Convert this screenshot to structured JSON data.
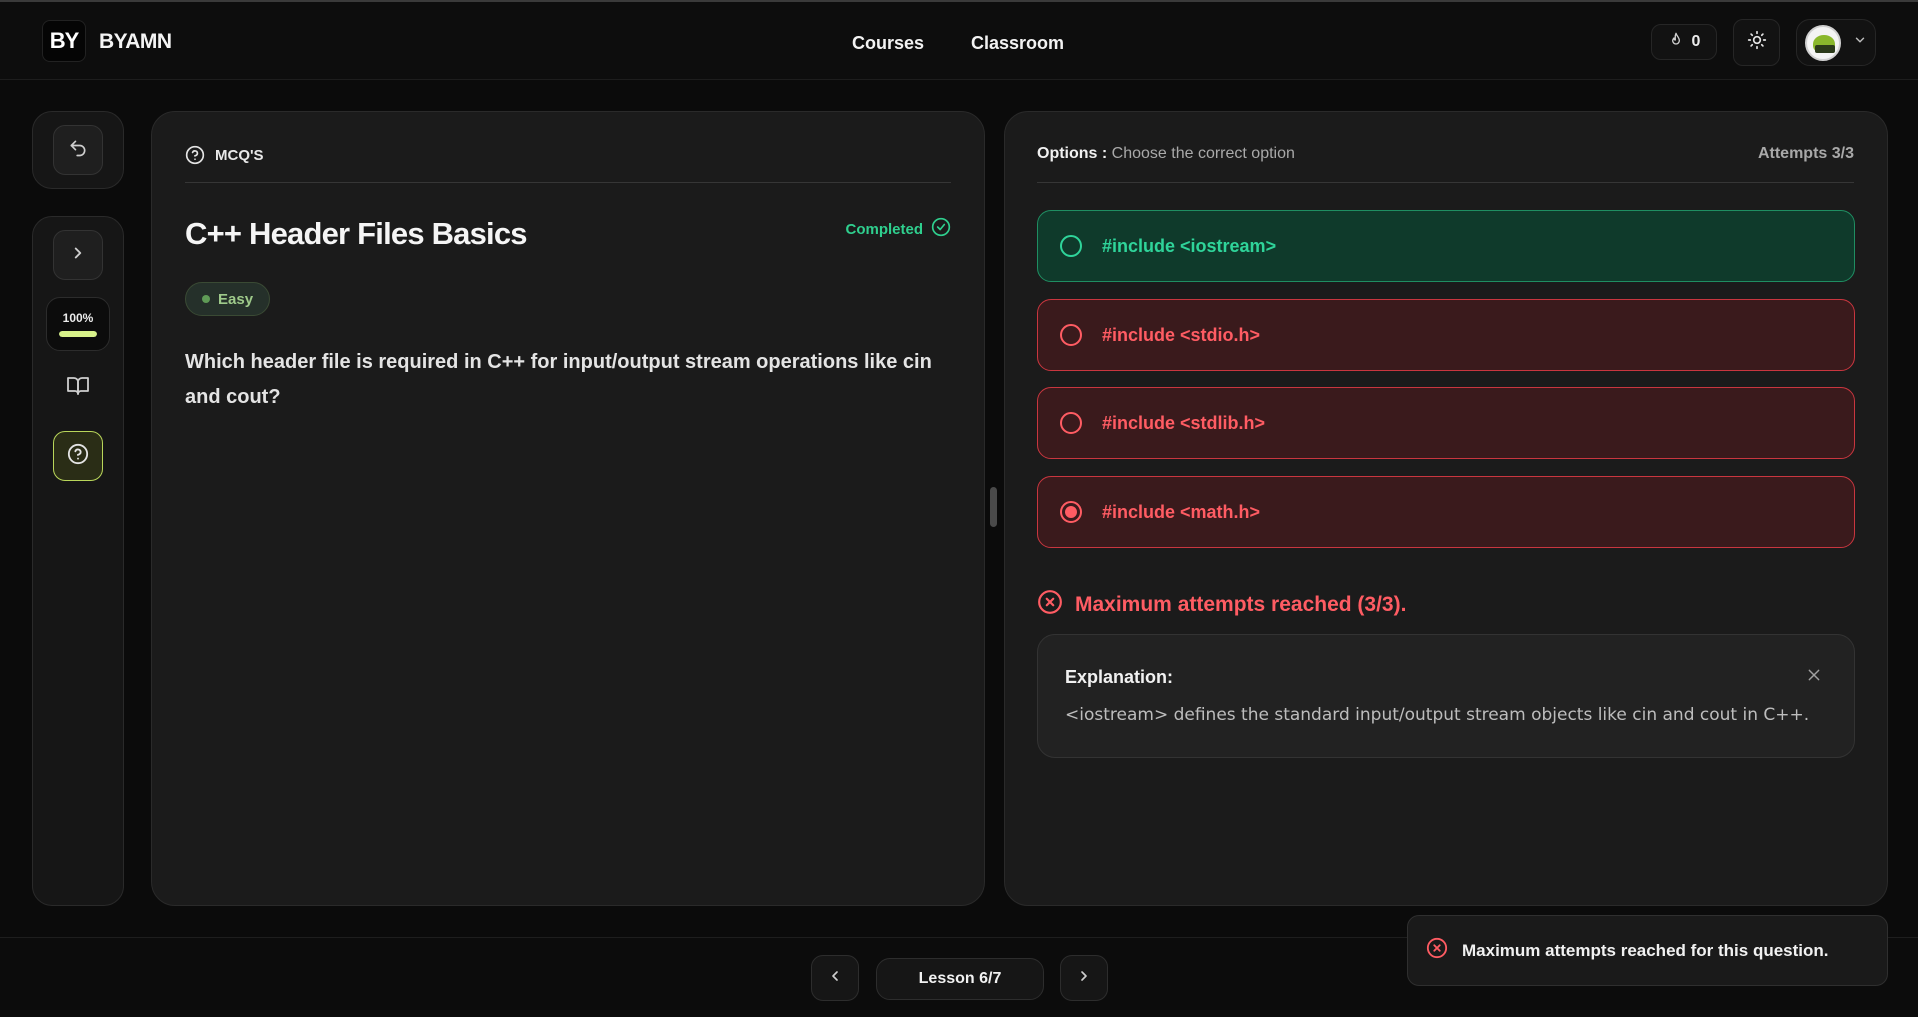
{
  "header": {
    "logo_text": "BY",
    "brand": "BYAMN",
    "nav": [
      "Courses",
      "Classroom"
    ],
    "streak_count": "0"
  },
  "sidebar": {
    "progress_label": "100%",
    "progress_value": 1.0
  },
  "question_panel": {
    "section_label": "MCQ'S",
    "title": "C++ Header Files Basics",
    "status": "Completed",
    "difficulty": "Easy",
    "question": "Which header file is required in C++ for input/output stream operations like cin and cout?"
  },
  "options_panel": {
    "label": "Options :",
    "instruction": "Choose the correct option",
    "attempts": "Attempts 3/3",
    "options": [
      {
        "text": "#include <iostream>",
        "state": "correct",
        "selected": false
      },
      {
        "text": "#include <stdio.h>",
        "state": "wrong",
        "selected": false
      },
      {
        "text": "#include <stdlib.h>",
        "state": "wrong",
        "selected": false
      },
      {
        "text": "#include <math.h>",
        "state": "wrong",
        "selected": true
      }
    ],
    "max_attempts_message": "Maximum attempts reached (3/3).",
    "explanation_title": "Explanation:",
    "explanation_text": "<iostream> defines the standard input/output stream objects like cin and cout in C++."
  },
  "footer": {
    "lesson_label": "Lesson 6/7"
  },
  "toast": {
    "message": "Maximum attempts reached for this question."
  },
  "colors": {
    "correct": "#2fd49a",
    "wrong": "#ff5c63",
    "accent": "#d8f28a"
  }
}
